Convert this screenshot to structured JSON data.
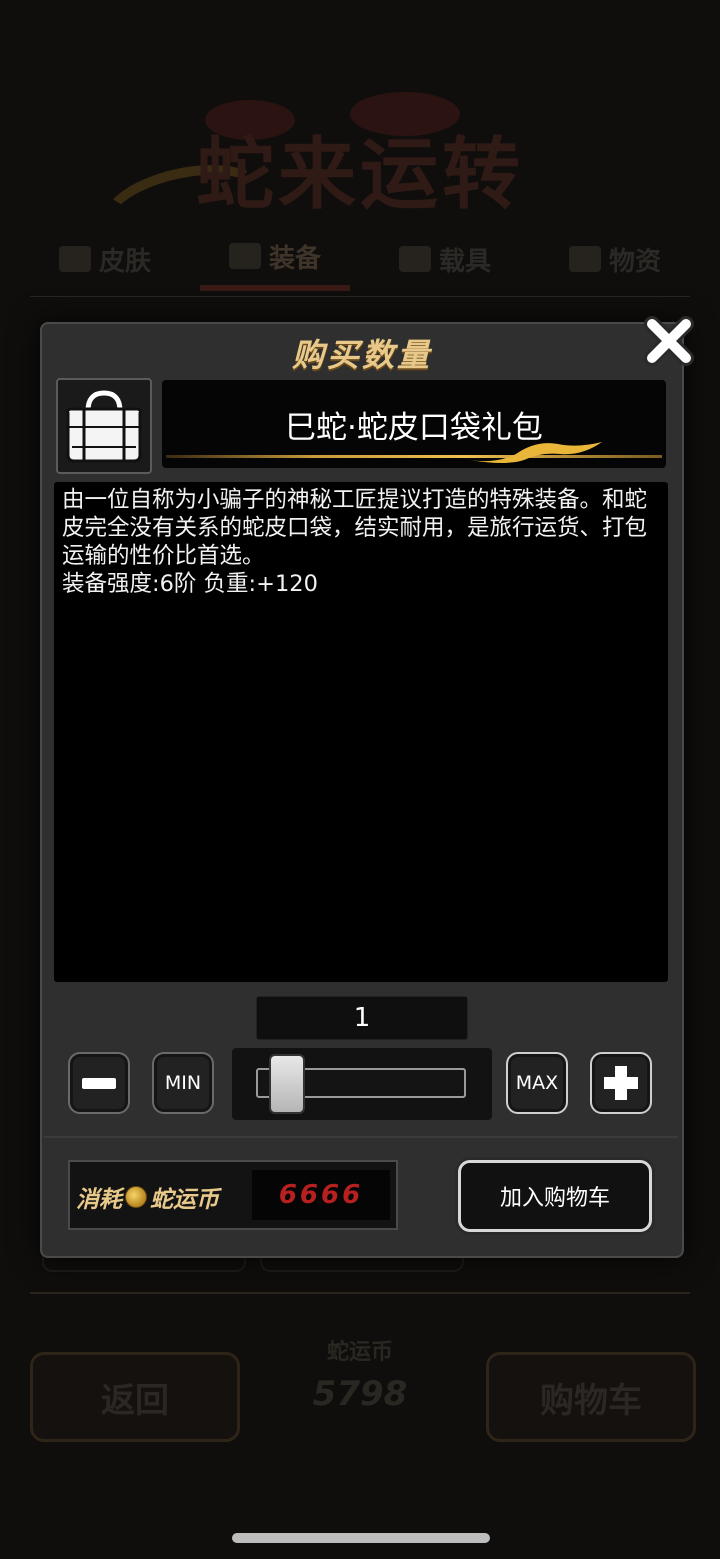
{
  "background": {
    "title": "蛇来运转",
    "tabs": [
      {
        "label": "皮肤",
        "icon": "box-icon"
      },
      {
        "label": "装备",
        "icon": "shield-icon"
      },
      {
        "label": "载具",
        "icon": "car-icon"
      },
      {
        "label": "物资",
        "icon": "truck-icon"
      }
    ],
    "back_label": "返回",
    "coin_label": "蛇运币",
    "coin_balance": "5798",
    "cart_label": "购物车"
  },
  "dialog": {
    "title": "购买数量",
    "close_icon": "close-icon",
    "item_icon": "bag-icon",
    "item_name": "巳蛇·蛇皮口袋礼包",
    "description": "由一位自称为小骗子的神秘工匠提议打造的特殊装备。和蛇皮完全没有关系的蛇皮口袋，结实耐用，是旅行运货、打包运输的性价比首选。\n装备强度:6阶  负重:+120",
    "quantity": "1",
    "min_label": "MIN",
    "max_label": "MAX",
    "slider_value": 0.05,
    "cost_prefix": "消耗",
    "currency_name": "蛇运币",
    "cost_value": "6666",
    "add_to_cart_label": "加入购物车"
  },
  "colors": {
    "accent_gold": "#e8c98a",
    "cost_red": "#b8201f",
    "panel": "#2f2f2f"
  }
}
